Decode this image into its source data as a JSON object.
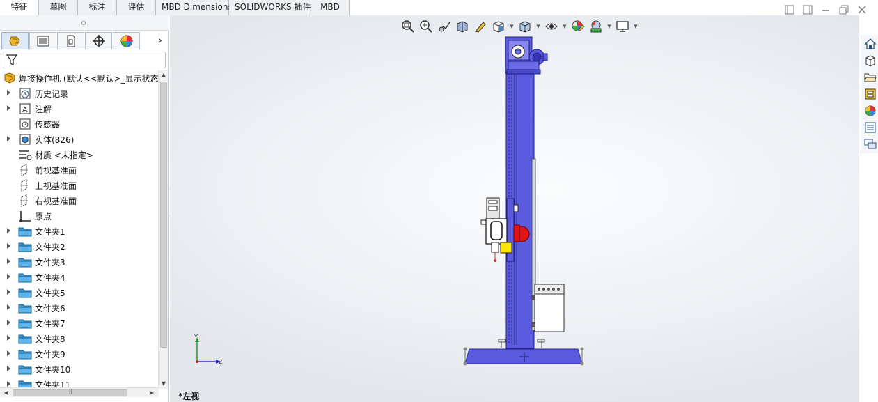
{
  "tabs": [
    {
      "label": "特征",
      "active": true
    },
    {
      "label": "草图",
      "active": false
    },
    {
      "label": "标注",
      "active": false
    },
    {
      "label": "评估",
      "active": false
    },
    {
      "label": "MBD Dimensions",
      "active": false
    },
    {
      "label": "SOLIDWORKS 插件",
      "active": false
    },
    {
      "label": "MBD",
      "active": false
    }
  ],
  "tree": {
    "root": "焊接操作机 (默认<<默认>_显示状态",
    "items": [
      {
        "label": "历史记录",
        "icon": "history-icon",
        "expandable": true
      },
      {
        "label": "注解",
        "icon": "annotation-icon",
        "expandable": true
      },
      {
        "label": "传感器",
        "icon": "sensor-icon",
        "expandable": false
      },
      {
        "label": "实体(826)",
        "icon": "solid-bodies-icon",
        "expandable": true
      },
      {
        "label": "材质 <未指定>",
        "icon": "material-icon",
        "expandable": false
      },
      {
        "label": "前视基准面",
        "icon": "plane-icon",
        "expandable": false
      },
      {
        "label": "上视基准面",
        "icon": "plane-icon",
        "expandable": false
      },
      {
        "label": "右视基准面",
        "icon": "plane-icon",
        "expandable": false
      },
      {
        "label": "原点",
        "icon": "origin-icon",
        "expandable": false
      },
      {
        "label": "文件夹1",
        "icon": "folder-icon",
        "expandable": true
      },
      {
        "label": "文件夹2",
        "icon": "folder-icon",
        "expandable": true
      },
      {
        "label": "文件夹3",
        "icon": "folder-icon",
        "expandable": true
      },
      {
        "label": "文件夹4",
        "icon": "folder-icon",
        "expandable": true
      },
      {
        "label": "文件夹5",
        "icon": "folder-icon",
        "expandable": true
      },
      {
        "label": "文件夹6",
        "icon": "folder-icon",
        "expandable": true
      },
      {
        "label": "文件夹7",
        "icon": "folder-icon",
        "expandable": true
      },
      {
        "label": "文件夹8",
        "icon": "folder-icon",
        "expandable": true
      },
      {
        "label": "文件夹9",
        "icon": "folder-icon",
        "expandable": true
      },
      {
        "label": "文件夹10",
        "icon": "folder-icon",
        "expandable": true
      },
      {
        "label": "文件夹11",
        "icon": "folder-icon",
        "expandable": true
      }
    ]
  },
  "graphics": {
    "view_label": "*左视",
    "triad": {
      "y": "Y",
      "z": "Z"
    }
  },
  "colors": {
    "model_blue": "#5b5be0",
    "model_red": "#e01414",
    "model_yellow": "#ffe600",
    "folder_blue": "#3a9ad9"
  }
}
